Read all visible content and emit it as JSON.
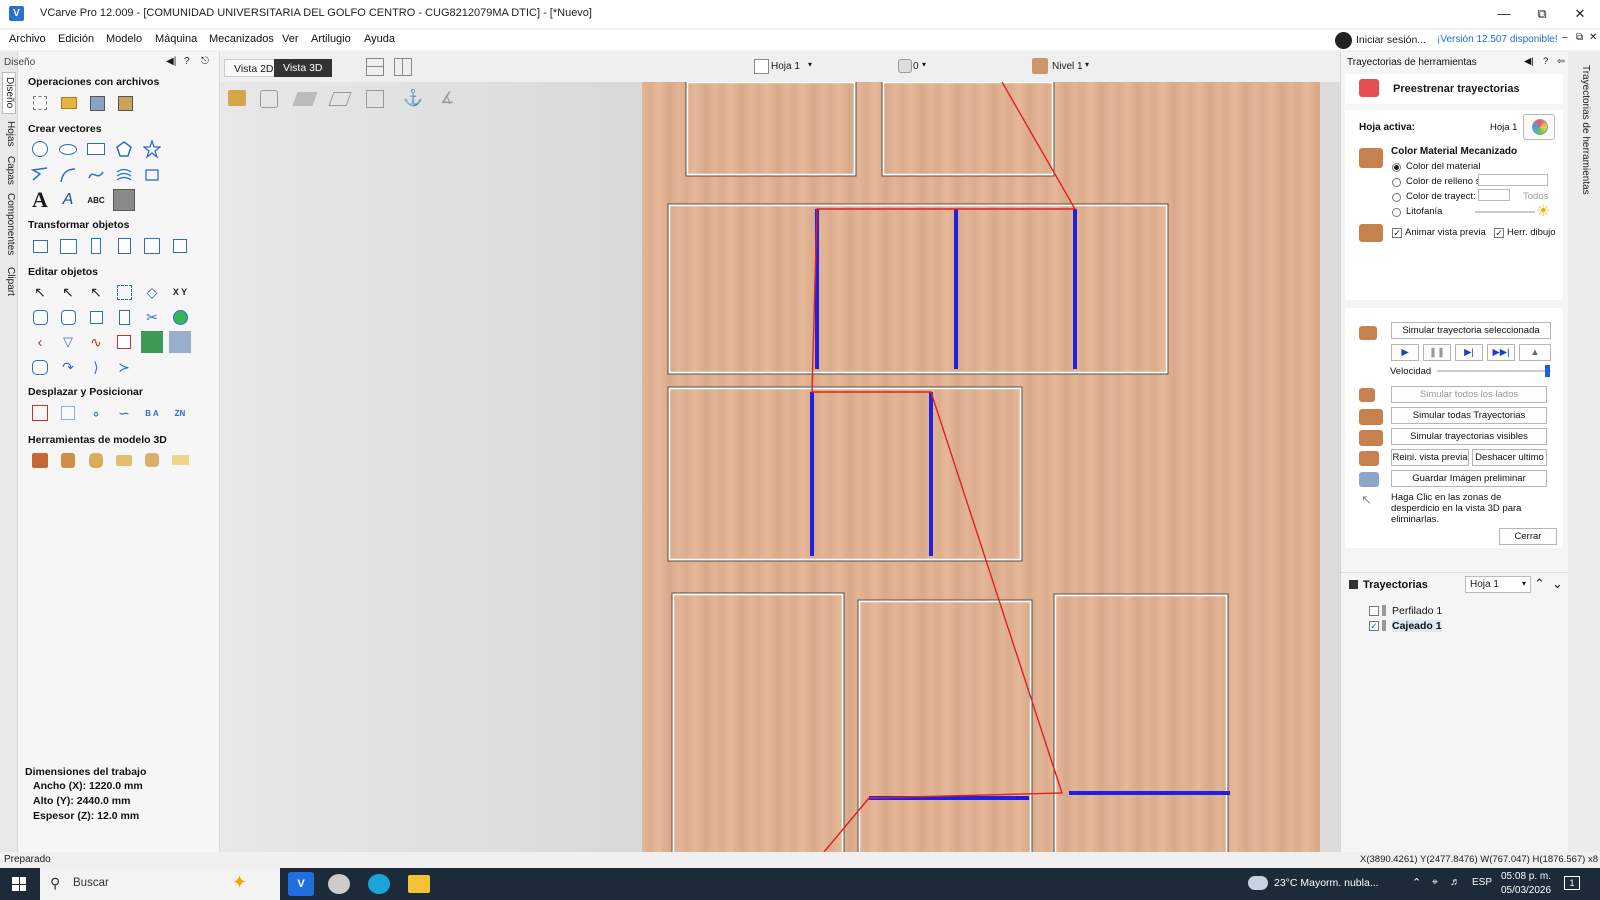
{
  "title": "VCarve Pro 12.009 - [COMUNIDAD UNIVERSITARIA DEL GOLFO CENTRO - CUG8212079MA DTIC] - [*Nuevo]",
  "menu": [
    "Archivo",
    "Edición",
    "Modelo",
    "Máquina",
    "Mecanizados",
    "Ver",
    "Artilugio",
    "Ayuda"
  ],
  "account": {
    "signin": "Iniciar sesión...",
    "version": "¡Versión 12.507 disponible!"
  },
  "left_tabs": [
    "Diseño",
    "Hojas",
    "Capas",
    "Componentes",
    "Clipart"
  ],
  "left_panel": {
    "header": "Diseño",
    "sections": [
      "Operaciones con archivos",
      "Crear vectores",
      "Transformar objetos",
      "Editar objetos",
      "Desplazar y Posicionar",
      "Herramientas de modelo 3D"
    ],
    "dims_title": "Dimensiones del trabajo",
    "dims": [
      "Ancho  (X): 1220.0 mm",
      "Alto   (Y): 2440.0 mm",
      "Espesor (Z): 12.0 mm"
    ]
  },
  "view": {
    "tab2d": "Vista 2D",
    "tab3d": "Vista 3D",
    "sheet": "Hoja 1",
    "count": "0",
    "level": "Nivel 1"
  },
  "right_panel": {
    "header": "Trayectorias de herramientas",
    "title": "Preestrenar trayectorias",
    "active_sheet_label": "Hoja activa:",
    "active_sheet": "Hoja 1",
    "color_title": "Color Material Mecanizado",
    "radios": [
      "Color del material",
      "Color de relleno s",
      "Color de trayect:",
      "Litofanía"
    ],
    "todos": "Todos",
    "animate": "Animar vista previa",
    "herr": "Herr. dibujo",
    "sim_selected": "Simular trayectoria seleccionada",
    "speed": "Velocidad",
    "sim_all_sides": "Simular todos los lados",
    "sim_all": "Simular todas Trayectorias",
    "sim_visible": "Simular trayectorias visibles",
    "reset": "Reini. vista previa",
    "undo": "Deshacer ultimo",
    "save_img": "Guardar Imágen preliminar",
    "hint": "Haga Clic en las zonas de desperdicio en la vista 3D para eliminarlas.",
    "close": "Cerrar",
    "toolpaths_title": "Trayectorias",
    "toolpaths_sheet": "Hoja 1",
    "toolpaths": [
      {
        "name": "Perfilado 1",
        "checked": false
      },
      {
        "name": "Cajeado 1",
        "checked": true
      }
    ],
    "strip": "Trayectorias de herramientas"
  },
  "status": {
    "left": "Preparado",
    "right": "X(3890.4261) Y(2477.8476)   W(767.047) H(1876.567) x8"
  },
  "taskbar": {
    "search": "Buscar",
    "weather": "23°C  Mayorm. nubla...",
    "lang": "ESP",
    "time": "05:08 p. m.",
    "date": "05/03/2026",
    "notif": "1"
  }
}
